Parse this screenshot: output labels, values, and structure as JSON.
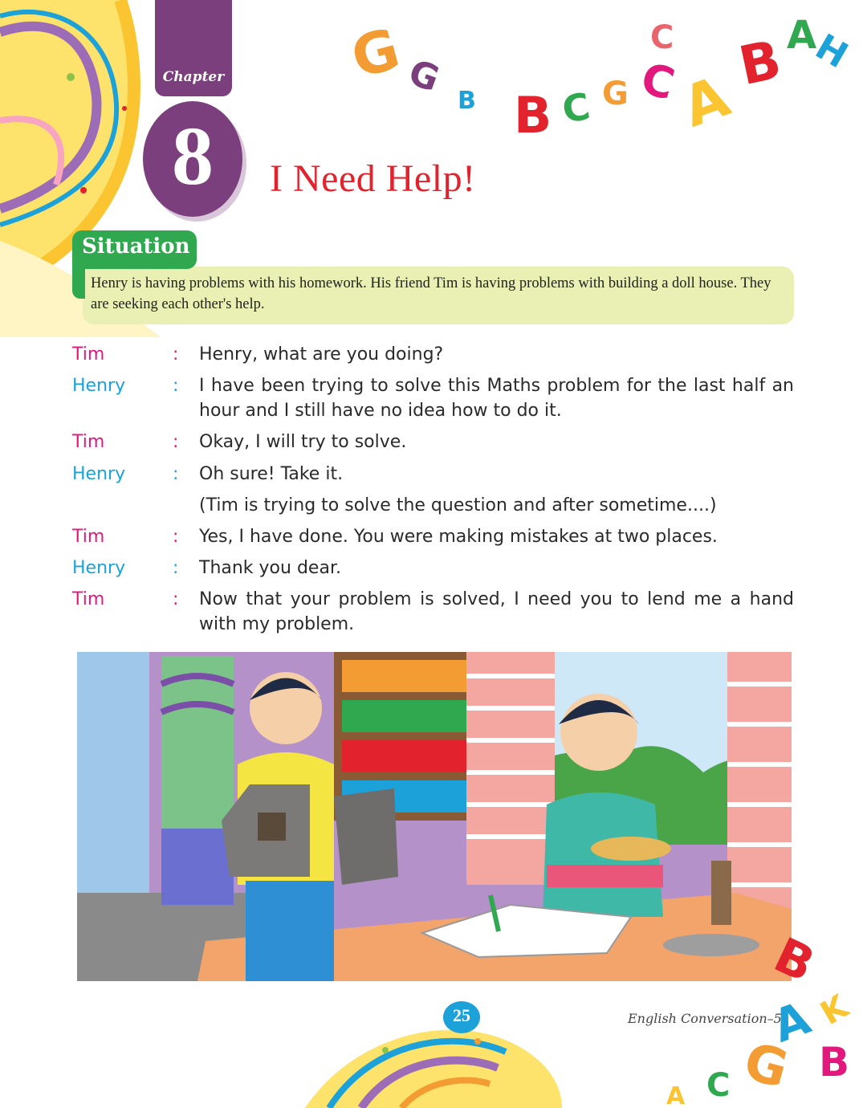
{
  "chapter": {
    "label": "Chapter",
    "number": "8",
    "title": "I Need Help!"
  },
  "situation": {
    "label": "Situation",
    "text": "Henry is having problems with his homework. His friend Tim is having problems with building a doll house. They are seeking each other's help."
  },
  "dialogue": [
    {
      "speaker": "Tim",
      "colon": ":",
      "text": "Henry, what are you doing?"
    },
    {
      "speaker": "Henry",
      "colon": ":",
      "text": "I have been trying to solve this Maths problem for the last half an hour and I still have no idea how to do it."
    },
    {
      "speaker": "Tim",
      "colon": ":",
      "text": "Okay, I will try to solve."
    },
    {
      "speaker": "Henry",
      "colon": ":",
      "text": "Oh sure! Take it."
    },
    {
      "speaker": "",
      "colon": "",
      "text": "(Tim is trying to solve the question and after sometime....)"
    },
    {
      "speaker": "Tim",
      "colon": ":",
      "text": "Yes, I have done. You were making mistakes at two places."
    },
    {
      "speaker": "Henry",
      "colon": ":",
      "text": "Thank you dear."
    },
    {
      "speaker": "Tim",
      "colon": ":",
      "text": "Now that your problem is solved, I need you to lend me a hand with my problem."
    }
  ],
  "footer": {
    "page_number": "25",
    "book_title": "English Conversation–5"
  },
  "colors": {
    "chapter": "#7b3f7e",
    "title": "#e2232e",
    "situation_tab": "#2fa84f",
    "situation_box": "#eaf0b3",
    "tim": "#e3187d",
    "henry": "#1ca2d9"
  }
}
